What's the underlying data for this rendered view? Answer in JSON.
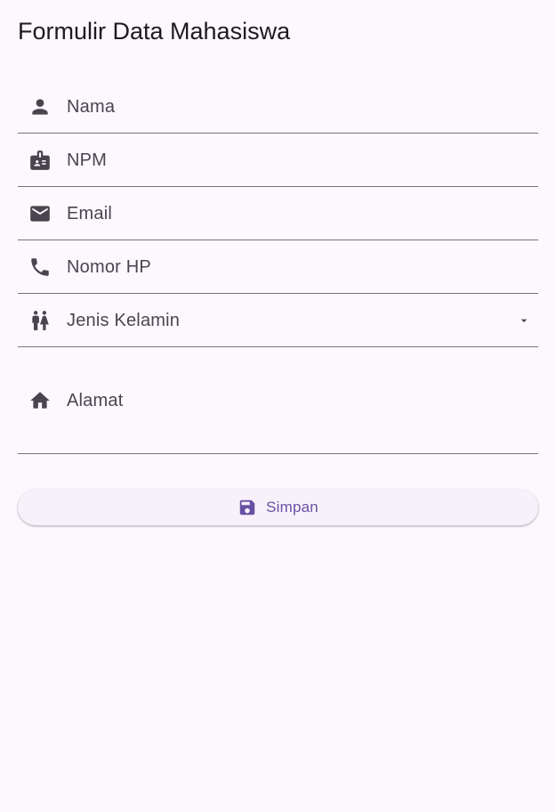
{
  "header": {
    "title": "Formulir Data Mahasiswa"
  },
  "form": {
    "fields": [
      {
        "label": "Nama",
        "icon": "person-icon"
      },
      {
        "label": "NPM",
        "icon": "badge-icon"
      },
      {
        "label": "Email",
        "icon": "email-icon"
      },
      {
        "label": "Nomor HP",
        "icon": "phone-icon"
      },
      {
        "label": "Jenis Kelamin",
        "icon": "wc-icon"
      },
      {
        "label": "Alamat",
        "icon": "home-icon"
      }
    ],
    "save_label": "Simpan",
    "save_icon": "save-icon"
  },
  "colors": {
    "background": "#fdf7fe",
    "primary": "#6750a4",
    "on_surface_variant": "#49454f",
    "outline": "#79747e"
  }
}
